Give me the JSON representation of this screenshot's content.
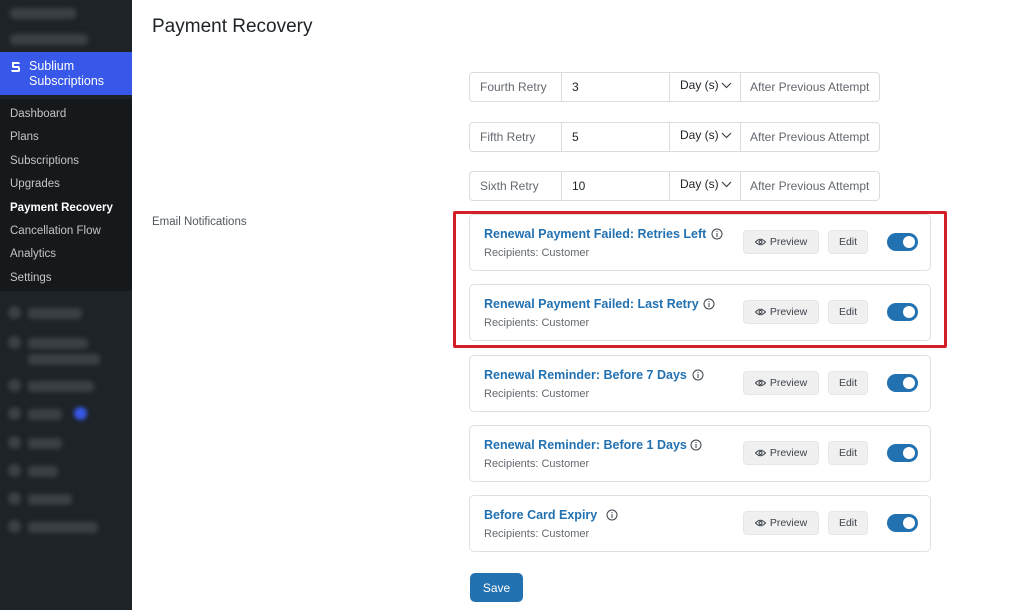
{
  "sidebar": {
    "plugin_name": "Sublium Subscriptions",
    "logo_icon": "sublium-logo-icon",
    "items": [
      {
        "label": "Dashboard"
      },
      {
        "label": "Plans"
      },
      {
        "label": "Subscriptions"
      },
      {
        "label": "Upgrades"
      },
      {
        "label": "Payment Recovery",
        "active": true
      },
      {
        "label": "Cancellation Flow"
      },
      {
        "label": "Analytics"
      },
      {
        "label": "Settings"
      }
    ]
  },
  "page": {
    "title": "Payment Recovery",
    "email_section_label": "Email Notifications"
  },
  "retries": [
    {
      "label": "Fourth Retry",
      "value": "3",
      "unit": "Day (s)",
      "suffix": "After Previous Attempt"
    },
    {
      "label": "Fifth Retry",
      "value": "5",
      "unit": "Day (s)",
      "suffix": "After Previous Attempt"
    },
    {
      "label": "Sixth Retry",
      "value": "10",
      "unit": "Day (s)",
      "suffix": "After Previous Attempt"
    }
  ],
  "emails": [
    {
      "title": "Renewal Payment Failed: Retries Left",
      "recipients": "Recipients: Customer",
      "enabled": true
    },
    {
      "title": "Renewal Payment Failed: Last Retry",
      "recipients": "Recipients: Customer",
      "enabled": true
    },
    {
      "title": "Renewal Reminder: Before 7 Days",
      "recipients": "Recipients: Customer",
      "enabled": true
    },
    {
      "title": "Renewal Reminder: Before 1 Days",
      "recipients": "Recipients: Customer",
      "enabled": true
    },
    {
      "title": "Before Card Expiry",
      "recipients": "Recipients: Customer",
      "enabled": true
    }
  ],
  "buttons": {
    "preview": "Preview",
    "edit": "Edit",
    "save": "Save"
  },
  "colors": {
    "accent": "#2271b1",
    "plugin_header": "#3858e9",
    "highlight_border": "#d31f26",
    "sidebar_bg": "#1d2327"
  }
}
